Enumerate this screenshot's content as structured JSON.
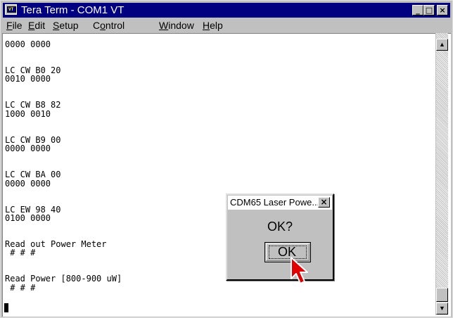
{
  "window": {
    "title": "Tera Term - COM1 VT",
    "app_icon_glyph": "VT",
    "controls": {
      "minimize": "_",
      "maximize": "□",
      "close": "×"
    }
  },
  "menubar": {
    "items": [
      {
        "label": "File",
        "mnemonic": "F"
      },
      {
        "label": "Edit",
        "mnemonic": "E"
      },
      {
        "label": "Setup",
        "mnemonic": "S"
      },
      {
        "label": "Control",
        "mnemonic": "o"
      },
      {
        "label": "Window",
        "mnemonic": "W"
      },
      {
        "label": "Help",
        "mnemonic": "H"
      }
    ]
  },
  "terminal": {
    "lines": [
      "0000 0000",
      "",
      "",
      "LC CW B0 20",
      "0010 0000",
      "",
      "",
      "LC CW B8 82",
      "1000 0010",
      "",
      "",
      "LC CW B9 00",
      "0000 0000",
      "",
      "",
      "LC CW BA 00",
      "0000 0000",
      "",
      "",
      "LC EW 98 40",
      "0100 0000",
      "",
      "",
      "Read out Power Meter",
      " # # #",
      "",
      "",
      "Read Power [800-900 uW]",
      " # # #"
    ]
  },
  "scrollbar": {
    "up": "▲",
    "down": "▼"
  },
  "dialog": {
    "title": "CDM65 Laser Powe...",
    "close": "×",
    "message": "OK?",
    "ok_label": "OK"
  },
  "colors": {
    "titlebar": "#000080",
    "chrome": "#c0c0c0",
    "terminal_bg": "#ffffff",
    "pointer": "#e00000"
  }
}
